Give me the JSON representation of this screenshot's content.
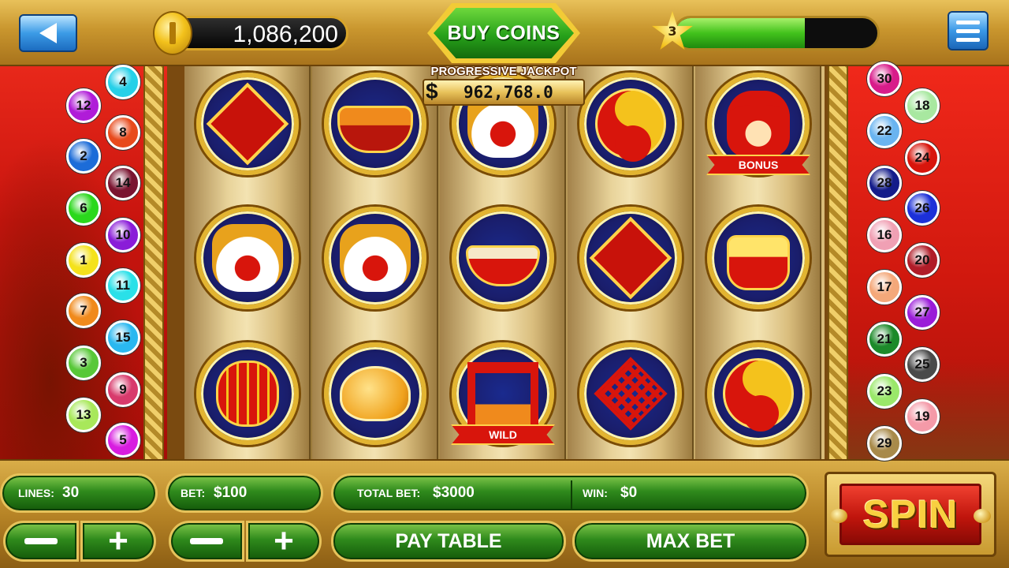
{
  "header": {
    "back_icon": "back-arrow-icon",
    "coins": "1,086,200",
    "buy_coins_label": "BUY COINS",
    "level": "3",
    "level_progress_percent": 64,
    "menu_icon": "hamburger-menu-icon"
  },
  "jackpot": {
    "title": "PROGRESSIVE JACKPOT",
    "currency": "$",
    "value": "962,768.0"
  },
  "paylines": {
    "left": [
      "4",
      "12",
      "8",
      "2",
      "14",
      "6",
      "10",
      "1",
      "11",
      "7",
      "15",
      "3",
      "9",
      "13",
      "5"
    ],
    "right": [
      "30",
      "18",
      "22",
      "24",
      "28",
      "26",
      "16",
      "20",
      "17",
      "27",
      "21",
      "25",
      "23",
      "19",
      "29"
    ],
    "colors": {
      "1": "#f4e21c",
      "2": "#1c6cd8",
      "3": "#58c838",
      "4": "#26d0e8",
      "5": "#d81ce0",
      "6": "#2ad81c",
      "7": "#f08a1c",
      "8": "#e84a1c",
      "9": "#d83a6c",
      "10": "#8a1cd8",
      "11": "#2ae0e8",
      "12": "#b01cd8",
      "13": "#a8e85a",
      "14": "#7a1430",
      "15": "#2ab8f0",
      "16": "#f0a0b4",
      "17": "#f4a87a",
      "18": "#a8e8a0",
      "19": "#f49aa8",
      "20": "#b01c28",
      "21": "#1c8a2a",
      "22": "#6ab4f0",
      "23": "#9ae86a",
      "24": "#d8150c",
      "25": "#4a4a4a",
      "26": "#1c30d8",
      "27": "#9a1cd8",
      "28": "#141c8a",
      "29": "#a88a4a",
      "30": "#d81c8a"
    }
  },
  "reels": [
    [
      {
        "icon": "fu-diamond-icon",
        "ribbon": ""
      },
      {
        "icon": "lion-dance-icon",
        "ribbon": ""
      },
      {
        "icon": "red-lantern-icon",
        "ribbon": ""
      }
    ],
    [
      {
        "icon": "fruit-basket-icon",
        "ribbon": ""
      },
      {
        "icon": "lion-dance-icon",
        "ribbon": ""
      },
      {
        "icon": "fortune-cookie-icon",
        "ribbon": ""
      }
    ],
    [
      {
        "icon": "lion-dance-icon",
        "ribbon": ""
      },
      {
        "icon": "rice-bowl-icon",
        "ribbon": ""
      },
      {
        "icon": "temple-gate-icon",
        "ribbon": "WILD"
      }
    ],
    [
      {
        "icon": "yin-yang-icon",
        "ribbon": ""
      },
      {
        "icon": "fu-diamond-icon",
        "ribbon": ""
      },
      {
        "icon": "chinese-knot-icon",
        "ribbon": ""
      }
    ],
    [
      {
        "icon": "fortune-god-icon",
        "ribbon": "BONUS"
      },
      {
        "icon": "gold-ingot-pot-icon",
        "ribbon": ""
      },
      {
        "icon": "yin-yang-icon",
        "ribbon": ""
      }
    ]
  ],
  "controls": {
    "lines_label": "LINES:",
    "lines_value": "30",
    "bet_label": "BET:",
    "bet_value": "$100",
    "total_bet_label": "TOTAL BET:",
    "total_bet_value": "$3000",
    "win_label": "WIN:",
    "win_value": "$0",
    "minus_icon": "minus-icon",
    "plus_label": "+",
    "pay_table_label": "PAY TABLE",
    "max_bet_label": "MAX BET",
    "spin_label": "SPIN"
  }
}
